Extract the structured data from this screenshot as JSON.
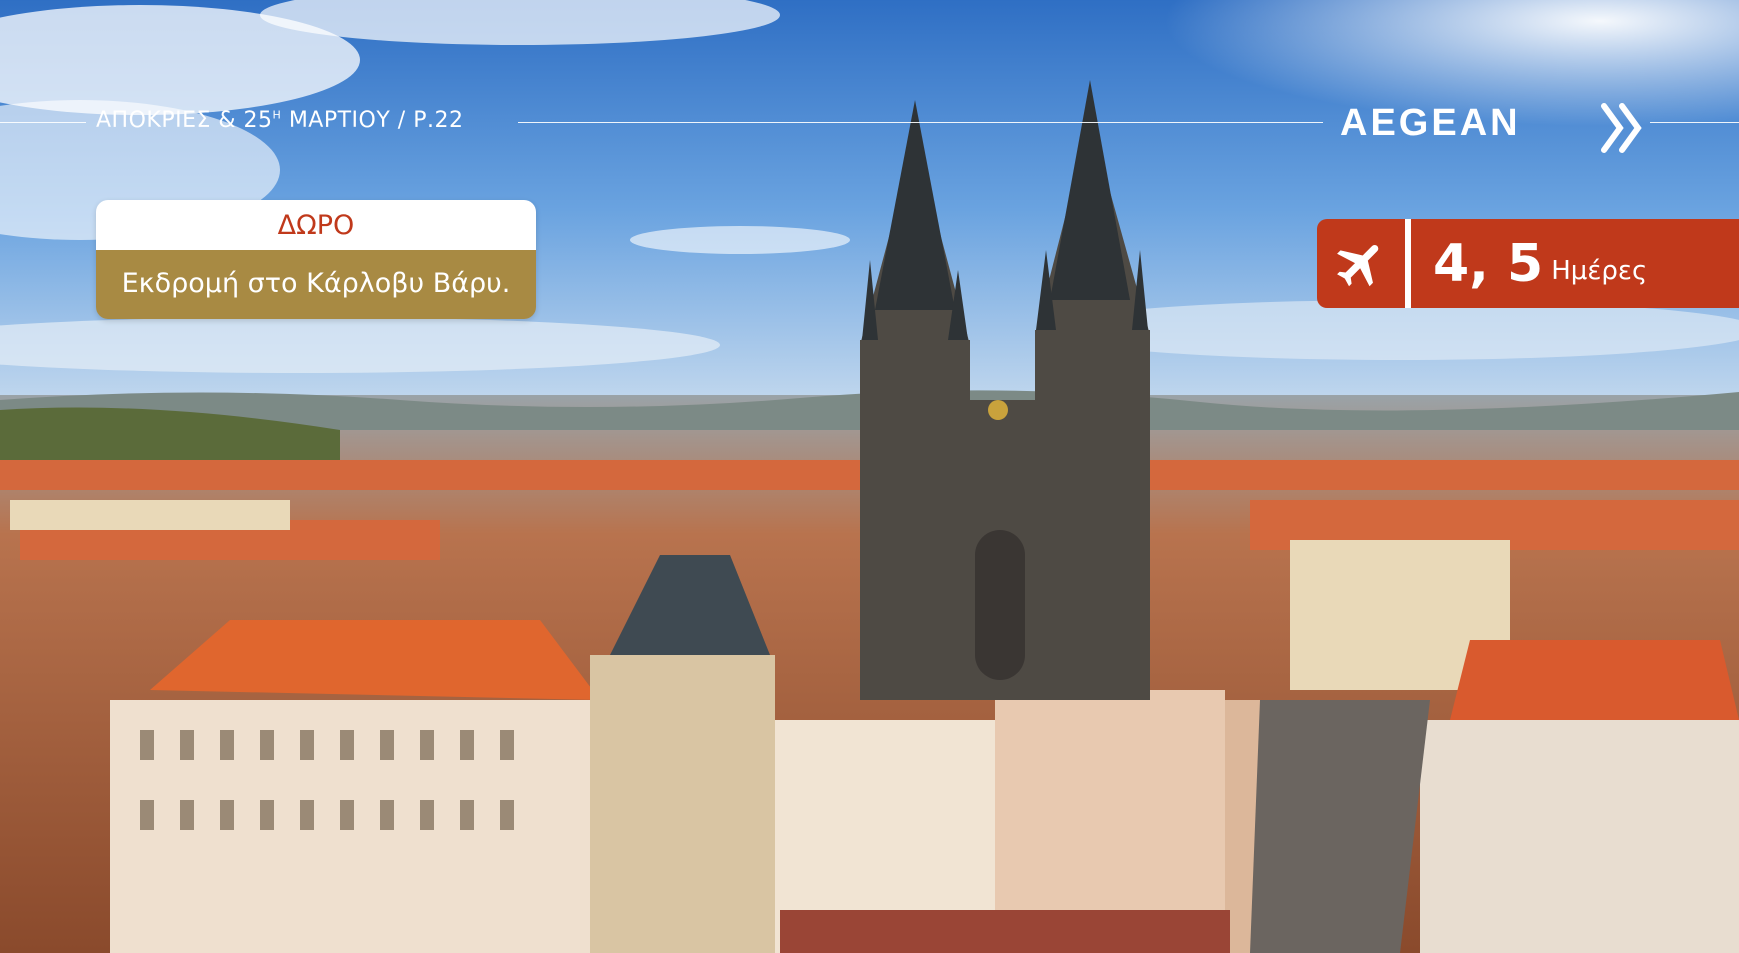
{
  "header": {
    "label": "ΑΠΟΚΡΙΕΣ & 25",
    "superscript": "Η",
    "label_rest": "ΜΑΡΤΙΟΥ / Ρ.22"
  },
  "brand": {
    "name": "AEGEAN",
    "mark_icon": "aegean-chevron-icon"
  },
  "gift": {
    "title": "ΔΩΡΟ",
    "text": "Εκδρομή στο Κάρλοβυ Βάρυ."
  },
  "duration": {
    "icon": "airplane-icon",
    "days": "4, 5",
    "unit": "Ημέρες"
  },
  "colors": {
    "accent_red": "#c0391b",
    "gift_gold": "#a88a43",
    "sky": "#5a8fd0"
  }
}
